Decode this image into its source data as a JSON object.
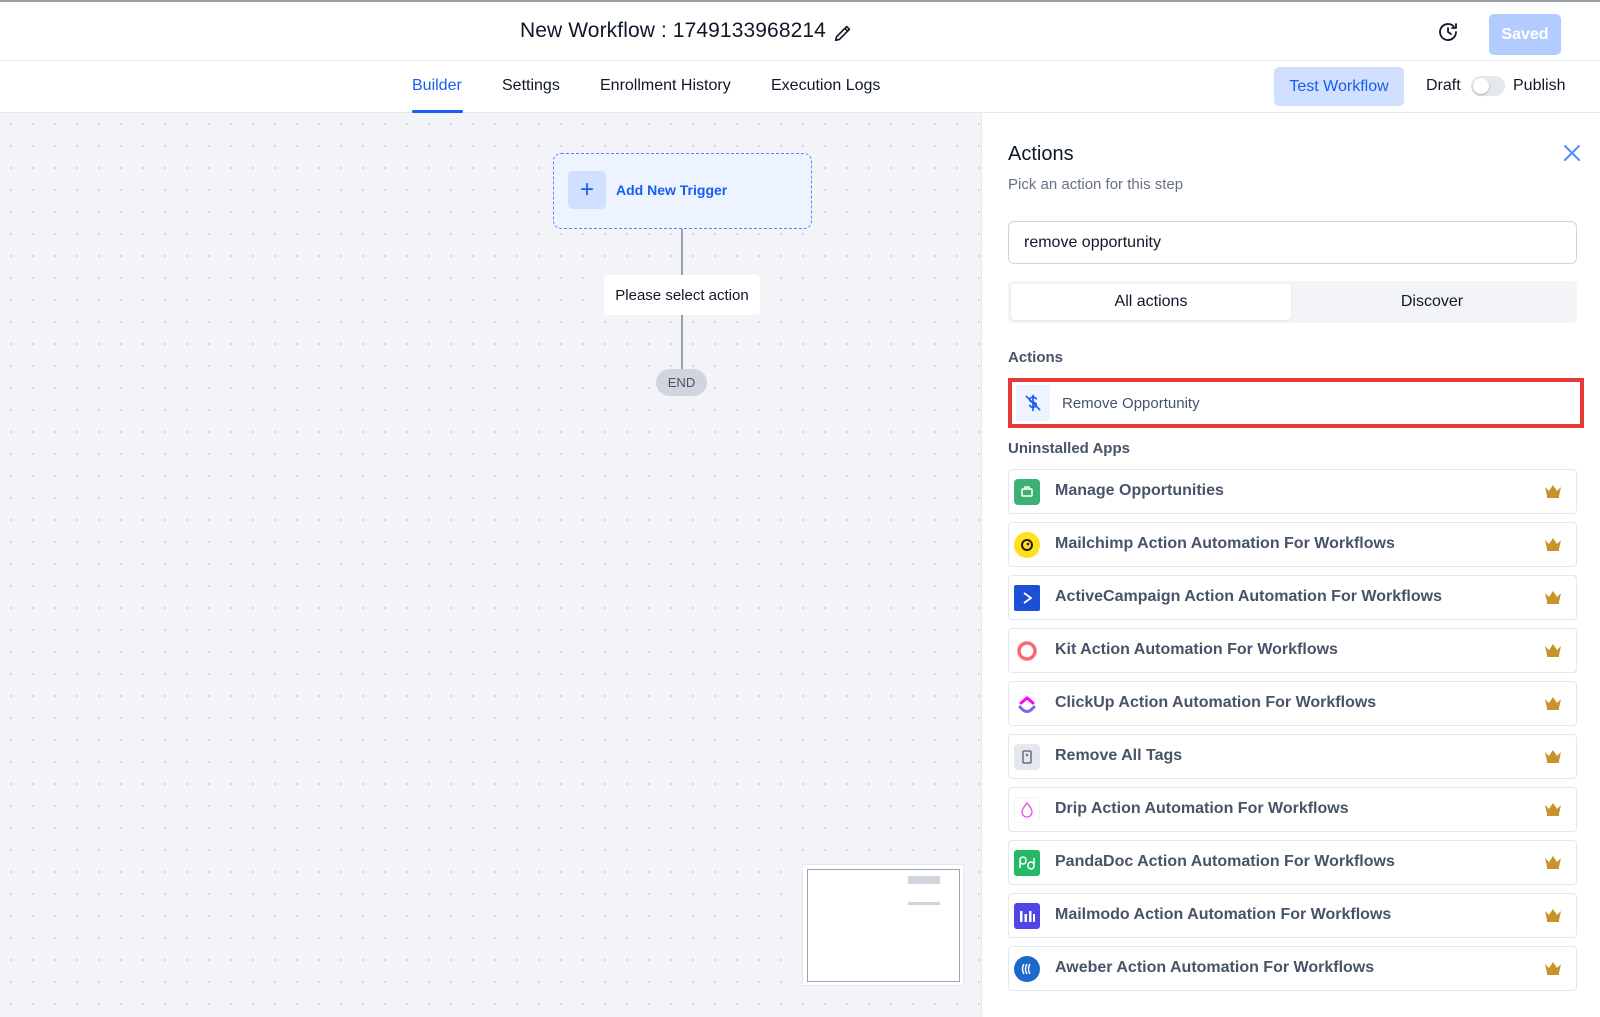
{
  "header": {
    "title": "New Workflow : 1749133968214",
    "saved_label": "Saved"
  },
  "tabs": [
    {
      "label": "Builder",
      "active": true
    },
    {
      "label": "Settings",
      "active": false
    },
    {
      "label": "Enrollment History",
      "active": false
    },
    {
      "label": "Execution Logs",
      "active": false
    }
  ],
  "toolbar": {
    "test_label": "Test Workflow",
    "draft_label": "Draft",
    "publish_label": "Publish",
    "published": false
  },
  "canvas": {
    "trigger_label": "Add New Trigger",
    "select_action_label": "Please select action",
    "end_label": "END"
  },
  "panel": {
    "title": "Actions",
    "subtitle": "Pick an action for this step",
    "search_value": "remove opportunity",
    "segments": [
      "All actions",
      "Discover"
    ],
    "actions_heading": "Actions",
    "actions": [
      {
        "label": "Remove Opportunity",
        "icon": "dollar-off-icon"
      }
    ],
    "uninstalled_heading": "Uninstalled Apps",
    "apps": [
      {
        "label": "Manage Opportunities",
        "icon": "manage-opportunities-icon",
        "color": "#3bb273"
      },
      {
        "label": "Mailchimp Action Automation For Workflows",
        "icon": "mailchimp-icon",
        "color": "#ffe01b"
      },
      {
        "label": "ActiveCampaign Action Automation For Workflows",
        "icon": "activecampaign-icon",
        "color": "#1d4ed8"
      },
      {
        "label": "Kit Action Automation For Workflows",
        "icon": "kit-icon",
        "color": "#fb6970"
      },
      {
        "label": "ClickUp Action Automation For Workflows",
        "icon": "clickup-icon",
        "color": "#7b68ee"
      },
      {
        "label": "Remove All Tags",
        "icon": "tags-icon",
        "color": "#98a2b3"
      },
      {
        "label": "Drip Action Automation For Workflows",
        "icon": "drip-icon",
        "color": "#e84fe6"
      },
      {
        "label": "PandaDoc Action Automation For Workflows",
        "icon": "pandadoc-icon",
        "color": "#25b869"
      },
      {
        "label": "Mailmodo Action Automation For Workflows",
        "icon": "mailmodo-icon",
        "color": "#4f46e5"
      },
      {
        "label": "Aweber Action Automation For Workflows",
        "icon": "aweber-icon",
        "color": "#1b6ac9"
      }
    ]
  }
}
